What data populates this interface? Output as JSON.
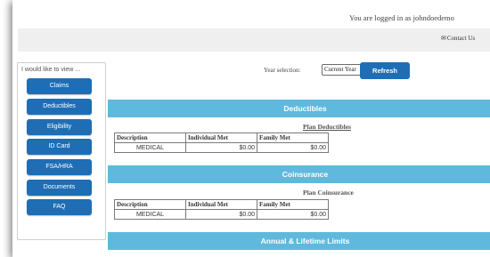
{
  "header": {
    "login_text": "You are logged in as johndoedemo",
    "contact_label": "Contact Us"
  },
  "sidebar": {
    "title": "I would like to view ...",
    "items": [
      {
        "label": "Claims"
      },
      {
        "label": "Deductibles"
      },
      {
        "label": "Eligibility"
      },
      {
        "label": "ID Card"
      },
      {
        "label": "FSA/HRA"
      },
      {
        "label": "Documents"
      },
      {
        "label": "FAQ"
      }
    ]
  },
  "year": {
    "label": "Year selection:",
    "selected": "Current Year",
    "refresh_label": "Refresh"
  },
  "deductibles": {
    "header": "Deductibles",
    "plan_title": "Plan Deductibles",
    "columns": [
      "Description",
      "Individual Met",
      "Family Met"
    ],
    "rows": [
      [
        "MEDICAL",
        "$0.00",
        "$0.00"
      ]
    ]
  },
  "coinsurance": {
    "header": "Coinsurance",
    "plan_title": "Plan Coinsurance",
    "columns": [
      "Description",
      "Individual Met",
      "Family Met"
    ],
    "rows": [
      [
        "MEDICAL",
        "$0.00",
        "$0.00"
      ]
    ]
  },
  "limits": {
    "header": "Annual & Lifetime Limits"
  },
  "colors": {
    "accent": "#1f6eb5",
    "section_header": "#5fb9dc",
    "contact_bar": "#efefef"
  }
}
